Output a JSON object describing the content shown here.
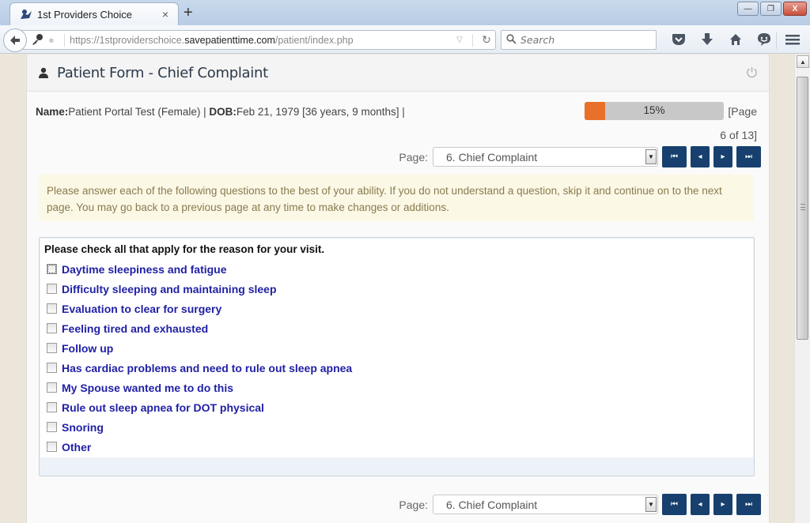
{
  "browser": {
    "tab_title": "1st Providers Choice",
    "tab_close": "×",
    "new_tab": "+",
    "url_prefix": "https://1stproviderschoice.",
    "url_domain": "savepatienttime.com",
    "url_path": "/patient/index.php",
    "search_placeholder": "Search",
    "window_buttons": {
      "minimize": "—",
      "restore": "❐",
      "close": "X"
    }
  },
  "panel": {
    "title": "Patient Form - Chief Complaint",
    "patient": {
      "name_label": "Name:",
      "name_value": "Patient Portal Test (Female) | ",
      "dob_label": "DOB:",
      "dob_value": "Feb 21, 1979  [36 years, 9 months] |"
    },
    "progress": {
      "percent": 15,
      "label": "15%"
    },
    "page_indicator_line1": "[Page",
    "page_indicator_line2": "6 of 13]"
  },
  "pager": {
    "label": "Page:",
    "selected": "6. Chief Complaint",
    "buttons": {
      "first": "⏮",
      "prev": "◂",
      "next": "▸",
      "last": "⏭"
    }
  },
  "info_text": "Please answer each of the following questions to the best of your ability. If you do not understand a question, skip it and continue on to the next page. You may go back to a previous page at any time to make changes or additions.",
  "question": {
    "title": "Please check all that apply for the reason for your visit.",
    "options": [
      {
        "label": "Daytime sleepiness and fatigue",
        "checked": false
      },
      {
        "label": "Difficulty sleeping and maintaining sleep",
        "checked": false
      },
      {
        "label": "Evaluation to clear for surgery",
        "checked": false
      },
      {
        "label": "Feeling tired and exhausted",
        "checked": false
      },
      {
        "label": "Follow up",
        "checked": false
      },
      {
        "label": "Has cardiac problems and need to rule out sleep apnea",
        "checked": false
      },
      {
        "label": "My Spouse wanted me to do this",
        "checked": false
      },
      {
        "label": "Rule out sleep apnea for DOT physical",
        "checked": false
      },
      {
        "label": "Snoring",
        "checked": false
      },
      {
        "label": "Other",
        "checked": false
      }
    ]
  },
  "colors": {
    "progress_fill": "#e8702a",
    "nav_button": "#17406e",
    "option_text": "#1f1fa6",
    "info_bg": "#fcf8e6"
  }
}
